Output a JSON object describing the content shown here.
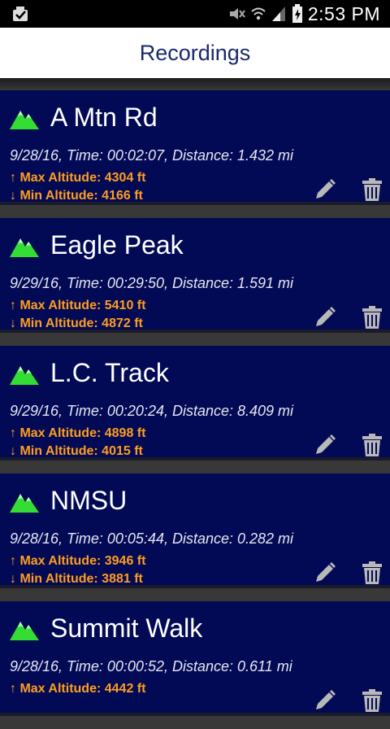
{
  "status_bar": {
    "time": "2:53 PM",
    "icons": [
      "download-notification-icon",
      "mute-icon",
      "wifi-icon",
      "signal-icon",
      "battery-charging-icon"
    ]
  },
  "header": {
    "title": "Recordings"
  },
  "colors": {
    "card_bg": "#020a55",
    "altitude_text": "#ff9d1e",
    "title_text": "#1a2a6c",
    "mountain_icon": "#33dd33"
  },
  "recordings": [
    {
      "name": "A Mtn Rd",
      "info": "9/28/16, Time: 00:02:07, Distance: 1.432 mi",
      "max_alt": "↑ Max Altitude: 4304 ft",
      "min_alt": "↓ Min Altitude: 4166 ft"
    },
    {
      "name": "Eagle Peak",
      "info": "9/29/16, Time: 00:29:50, Distance: 1.591 mi",
      "max_alt": "↑ Max Altitude: 5410 ft",
      "min_alt": "↓ Min Altitude: 4872 ft"
    },
    {
      "name": "L.C. Track",
      "info": "9/29/16, Time: 00:20:24, Distance: 8.409 mi",
      "max_alt": "↑ Max Altitude: 4898 ft",
      "min_alt": "↓ Min Altitude: 4015 ft"
    },
    {
      "name": "NMSU",
      "info": "9/28/16, Time: 00:05:44, Distance: 0.282 mi",
      "max_alt": "↑ Max Altitude: 3946 ft",
      "min_alt": "↓ Min Altitude: 3881 ft"
    },
    {
      "name": "Summit Walk",
      "info": "9/28/16, Time: 00:00:52, Distance: 0.611 mi",
      "max_alt": "↑ Max Altitude: 4442 ft",
      "min_alt": ""
    }
  ]
}
